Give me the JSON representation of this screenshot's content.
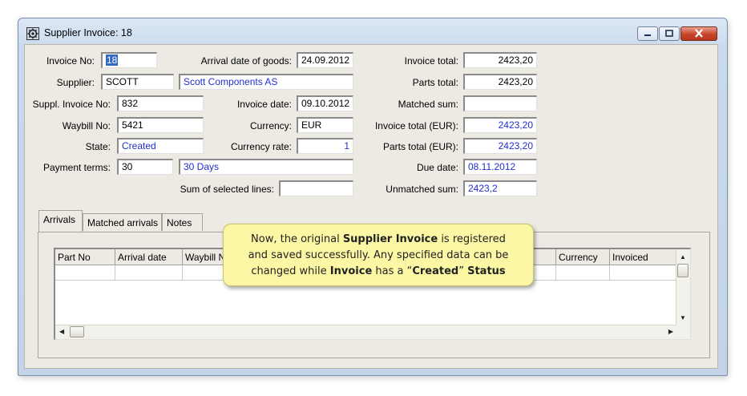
{
  "window": {
    "title": "Supplier Invoice: 18",
    "controls": {
      "minimize": "minimize-icon",
      "maximize": "maximize-icon",
      "close": "close-icon"
    }
  },
  "form": {
    "invoice_no": {
      "label": "Invoice No:",
      "value": "18"
    },
    "supplier": {
      "label": "Supplier:",
      "code": "SCOTT",
      "name": "Scott Components AS"
    },
    "suppl_invoice_no": {
      "label": "Suppl. Invoice No:",
      "value": "832"
    },
    "waybill_no": {
      "label": "Waybill No:",
      "value": "5421"
    },
    "state": {
      "label": "State:",
      "value": "Created"
    },
    "payment_terms": {
      "label": "Payment terms:",
      "code": "30",
      "desc": "30 Days"
    },
    "arrival_date": {
      "label": "Arrival date of goods:",
      "value": "24.09.2012"
    },
    "invoice_date": {
      "label": "Invoice date:",
      "value": "09.10.2012"
    },
    "currency": {
      "label": "Currency:",
      "value": "EUR"
    },
    "currency_rate": {
      "label": "Currency rate:",
      "value": "1"
    },
    "sum_selected": {
      "label": "Sum of selected lines:",
      "value": ""
    },
    "invoice_total": {
      "label": "Invoice total:",
      "value": "2423,20"
    },
    "parts_total": {
      "label": "Parts total:",
      "value": "2423,20"
    },
    "matched_sum": {
      "label": "Matched sum:",
      "value": ""
    },
    "invoice_total_eur": {
      "label": "Invoice total (EUR):",
      "value": "2423,20"
    },
    "parts_total_eur": {
      "label": "Parts total (EUR):",
      "value": "2423,20"
    },
    "due_date": {
      "label": "Due date:",
      "value": "08.11.2012"
    },
    "unmatched_sum": {
      "label": "Unmatched sum:",
      "value": "2423,2"
    }
  },
  "tabs": [
    {
      "label": "Arrivals"
    },
    {
      "label": "Matched arrivals"
    },
    {
      "label": "Notes"
    }
  ],
  "grid": {
    "columns": [
      "Part No",
      "Arrival date",
      "Waybill N",
      "Currency",
      "Invoiced"
    ]
  },
  "callout": {
    "line1_pre": "Now, the original ",
    "line1_bold": "Supplier Invoice",
    "line1_post": " is registered",
    "line2": "and saved successfully.  Any specified data can be",
    "line3_pre": "changed while ",
    "line3_bold1": "Invoice",
    "line3_mid": " has a “",
    "line3_bold2": "Created",
    "line3_post": "” ",
    "line3_bold3": "Status"
  }
}
